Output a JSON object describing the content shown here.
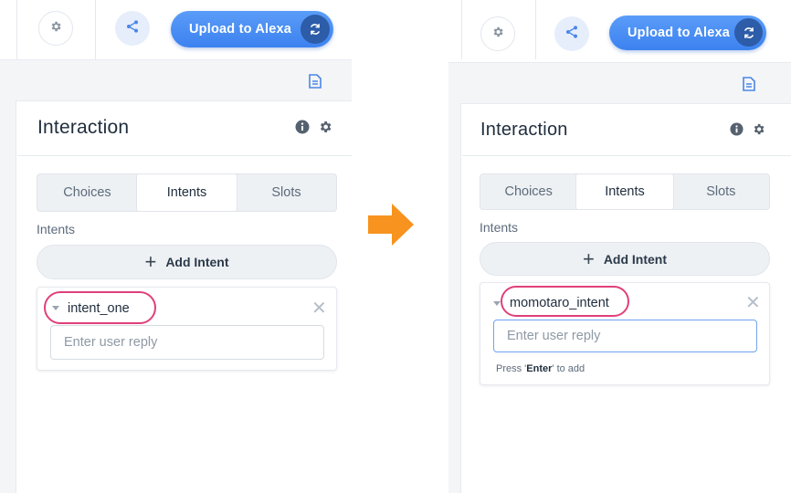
{
  "toolbar": {
    "upload_label": "Upload to Alexa"
  },
  "interaction": {
    "title": "Interaction",
    "tabs": [
      {
        "label": "Choices",
        "active": false
      },
      {
        "label": "Intents",
        "active": true
      },
      {
        "label": "Slots",
        "active": false
      }
    ],
    "section_label": "Intents",
    "add_intent_label": "Add Intent"
  },
  "before": {
    "intent_name": "intent_one",
    "reply_placeholder": "Enter user reply"
  },
  "after": {
    "intent_name": "momotaro_intent",
    "reply_placeholder": "Enter user reply",
    "hint_prefix": "Press '",
    "hint_key": "Enter",
    "hint_suffix": "' to add"
  },
  "colors": {
    "accent": "#3c82f0",
    "highlight": "#e0407a",
    "arrow": "#f7931e"
  }
}
